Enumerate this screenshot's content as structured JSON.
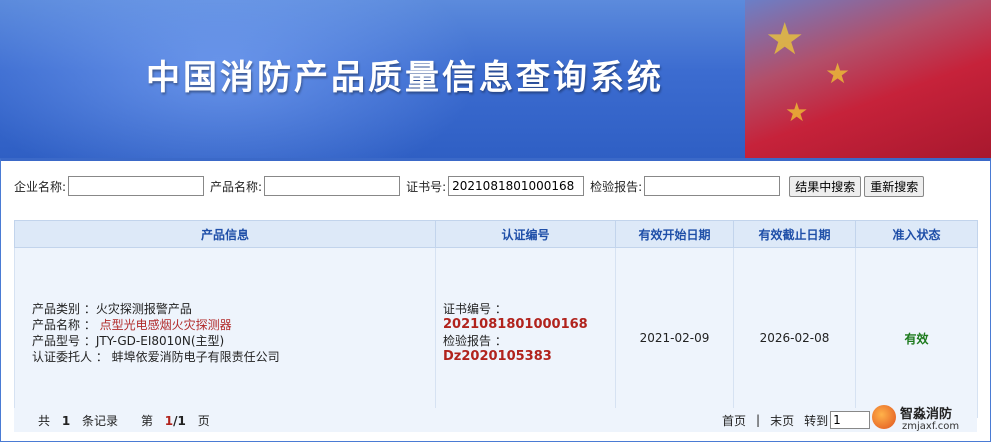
{
  "header": {
    "title": "中国消防产品质量信息查询系统"
  },
  "search": {
    "company_label": "企业名称:",
    "company_value": "",
    "product_label": "产品名称:",
    "product_value": "",
    "cert_label": "证书号:",
    "cert_value": "2021081801000168",
    "report_label": "检验报告:",
    "report_value": "",
    "search_in_results_label": "结果中搜索",
    "research_label": "重新搜索"
  },
  "table": {
    "headers": [
      "产品信息",
      "认证编号",
      "有效开始日期",
      "有效截止日期",
      "准入状态"
    ],
    "rows": [
      {
        "category_label": "产品类别 ：",
        "category": "火灾探测报警产品",
        "name_label": "产品名称 ：",
        "name": "点型光电感烟火灾探测器",
        "model_label": "产品型号 ：",
        "model": "JTY-GD-EI8010N(主型)",
        "client_label": "认证委托人 ：",
        "client": "蚌埠依爱消防电子有限责任公司",
        "cert_no_label": "证书编号 ：",
        "cert_no": "2021081801000168",
        "report_label": "检验报告 ：",
        "report_no": "Dz2020105383",
        "start_date": "2021-02-09",
        "end_date": "2026-02-08",
        "status": "有效"
      }
    ]
  },
  "pager": {
    "total_prefix": "共",
    "total_count": "1",
    "total_suffix": "条记录",
    "page_prefix": "第",
    "current_page": "1",
    "page_sep": "/",
    "total_pages": "1",
    "page_suffix": "页",
    "first_label": "首页",
    "separator": "|",
    "last_label": "末页",
    "goto_label": "转到",
    "goto_value": "1"
  },
  "watermark": {
    "name": "智淼消防",
    "site": "zmjaxf.com"
  },
  "colors": {
    "banner_blue": "#3c6cd0",
    "header_row": "#dde9f8",
    "header_text": "#1f4fa8",
    "cert_red": "#b1231d",
    "status_green": "#1d7a1d"
  }
}
